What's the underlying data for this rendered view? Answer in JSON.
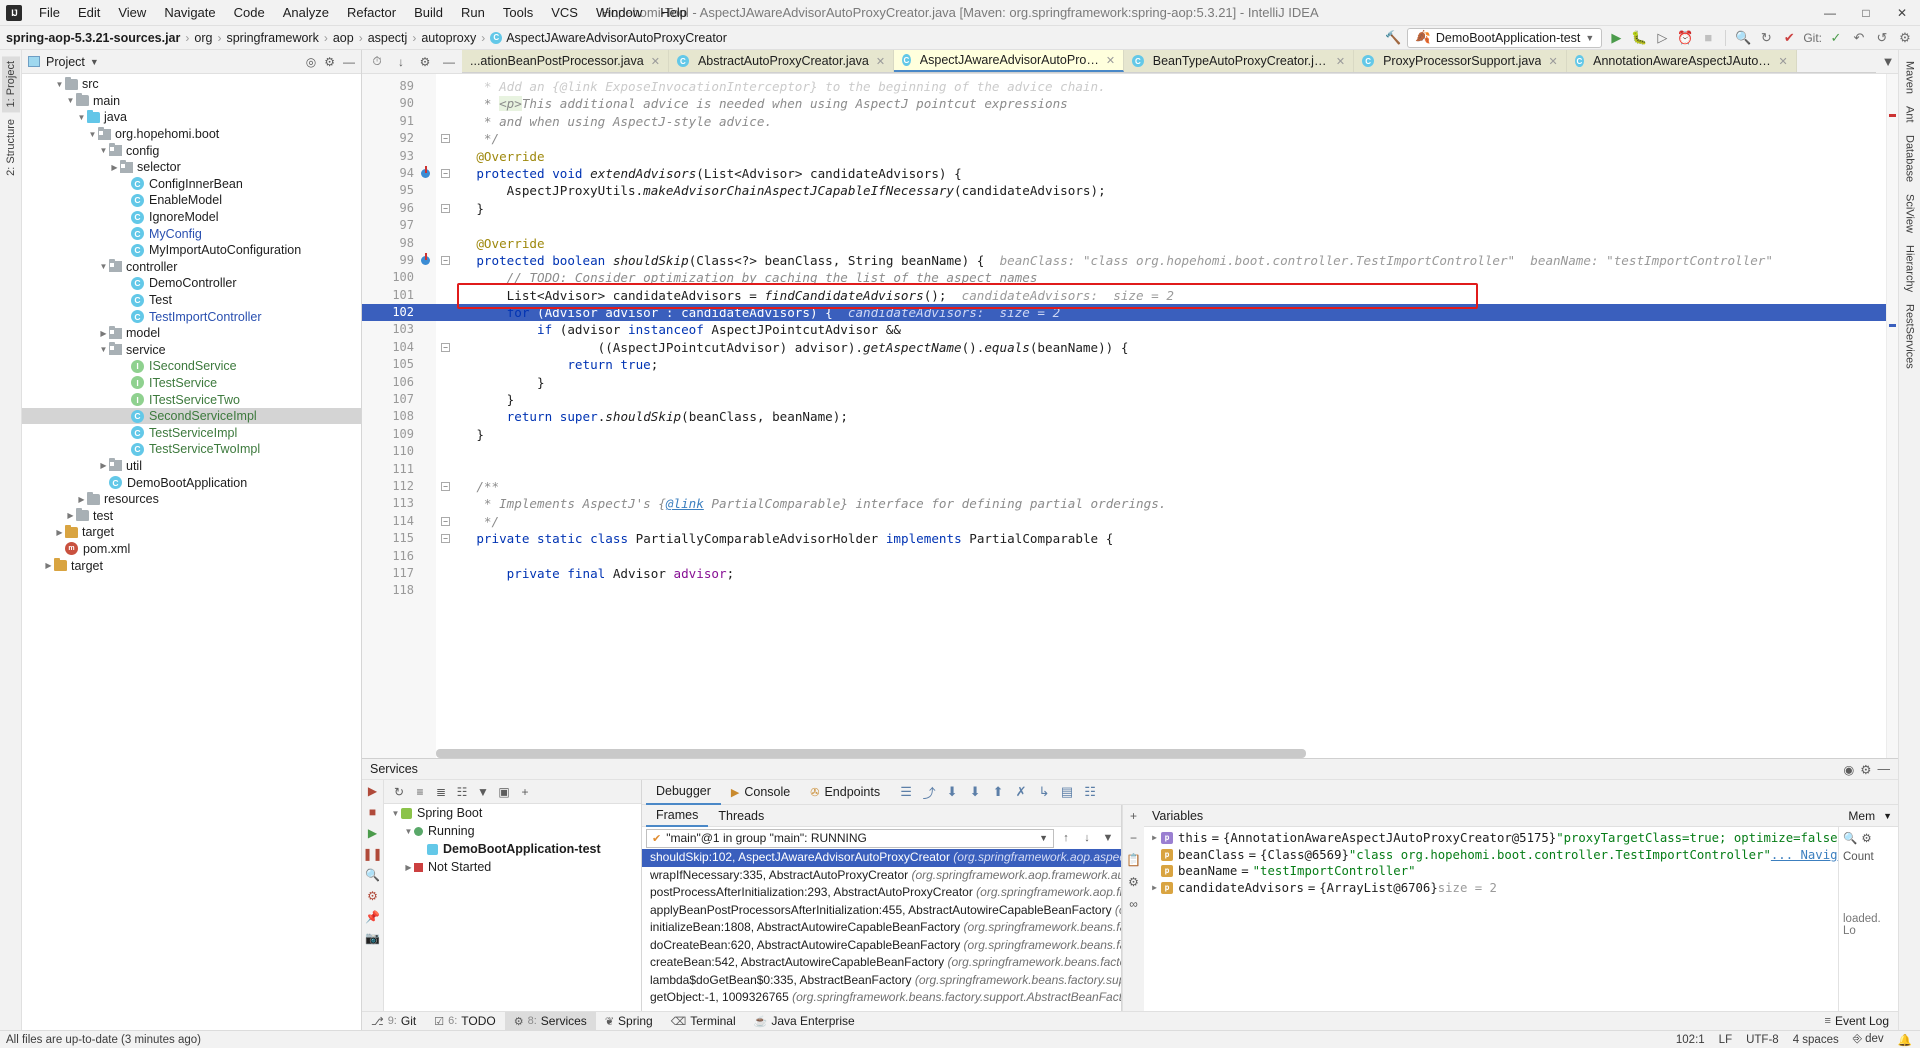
{
  "titlebar": {
    "logo": "IJ",
    "menus": [
      "File",
      "Edit",
      "View",
      "Navigate",
      "Code",
      "Analyze",
      "Refactor",
      "Build",
      "Run",
      "Tools",
      "VCS",
      "Window",
      "Help"
    ],
    "window_title": "Hopehomi-Tool - AspectJAwareAdvisorAutoProxyCreator.java [Maven: org.springframework:spring-aop:5.3.21] - IntelliJ IDEA",
    "minimize": "—",
    "maximize": "□",
    "close": "✕"
  },
  "navbar": {
    "crumbs": [
      "spring-aop-5.3.21-sources.jar",
      "org",
      "springframework",
      "aop",
      "aspectj",
      "autoproxy"
    ],
    "final_class": "AspectJAwareAdvisorAutoProxyCreator",
    "run_config": "DemoBootApplication-test",
    "git_label": "Git:"
  },
  "left_strip": {
    "tabs": [
      "1: Project",
      "2: Structure"
    ]
  },
  "right_strip": {
    "tabs": [
      "Maven",
      "Ant",
      "Database",
      "SciView",
      "Hierarchy",
      "RestServices"
    ]
  },
  "project": {
    "title": "Project",
    "tree": [
      {
        "indent": 2,
        "tw": "▼",
        "icon": "folder",
        "label": "src",
        "color": "dark"
      },
      {
        "indent": 3,
        "tw": "▼",
        "icon": "folder",
        "label": "main",
        "color": "dark"
      },
      {
        "indent": 4,
        "tw": "▼",
        "icon": "folder-blue",
        "label": "java",
        "color": "dark"
      },
      {
        "indent": 5,
        "tw": "▼",
        "icon": "pkg",
        "label": "org.hopehomi.boot",
        "color": "dark"
      },
      {
        "indent": 6,
        "tw": "▼",
        "icon": "pkg",
        "label": "config",
        "color": "dark"
      },
      {
        "indent": 7,
        "tw": "▶",
        "icon": "pkg",
        "label": "selector",
        "color": "dark"
      },
      {
        "indent": 8,
        "tw": "",
        "icon": "class",
        "label": "ConfigInnerBean",
        "color": "dark"
      },
      {
        "indent": 8,
        "tw": "",
        "icon": "class",
        "label": "EnableModel",
        "color": "dark"
      },
      {
        "indent": 8,
        "tw": "",
        "icon": "class",
        "label": "IgnoreModel",
        "color": "dark"
      },
      {
        "indent": 8,
        "tw": "",
        "icon": "class",
        "label": "MyConfig",
        "color": "blue"
      },
      {
        "indent": 8,
        "tw": "",
        "icon": "class",
        "label": "MyImportAutoConfiguration",
        "color": "dark"
      },
      {
        "indent": 6,
        "tw": "▼",
        "icon": "pkg",
        "label": "controller",
        "color": "dark"
      },
      {
        "indent": 8,
        "tw": "",
        "icon": "class",
        "label": "DemoController",
        "color": "dark"
      },
      {
        "indent": 8,
        "tw": "",
        "icon": "class",
        "label": "Test",
        "color": "dark"
      },
      {
        "indent": 8,
        "tw": "",
        "icon": "class",
        "label": "TestImportController",
        "color": "blue"
      },
      {
        "indent": 6,
        "tw": "▶",
        "icon": "pkg",
        "label": "model",
        "color": "dark"
      },
      {
        "indent": 6,
        "tw": "▼",
        "icon": "pkg",
        "label": "service",
        "color": "dark"
      },
      {
        "indent": 8,
        "tw": "",
        "icon": "iface",
        "label": "ISecondService",
        "color": "green"
      },
      {
        "indent": 8,
        "tw": "",
        "icon": "iface",
        "label": "ITestService",
        "color": "green"
      },
      {
        "indent": 8,
        "tw": "",
        "icon": "iface",
        "label": "ITestServiceTwo",
        "color": "green"
      },
      {
        "indent": 8,
        "tw": "",
        "icon": "class",
        "label": "SecondServiceImpl",
        "color": "green",
        "selected": true
      },
      {
        "indent": 8,
        "tw": "",
        "icon": "class",
        "label": "TestServiceImpl",
        "color": "green"
      },
      {
        "indent": 8,
        "tw": "",
        "icon": "class",
        "label": "TestServiceTwoImpl",
        "color": "green"
      },
      {
        "indent": 6,
        "tw": "▶",
        "icon": "pkg",
        "label": "util",
        "color": "dark"
      },
      {
        "indent": 6,
        "tw": "",
        "icon": "app",
        "label": "DemoBootApplication",
        "color": "dark"
      },
      {
        "indent": 4,
        "tw": "▶",
        "icon": "folder",
        "label": "resources",
        "color": "dark"
      },
      {
        "indent": 3,
        "tw": "▶",
        "icon": "folder",
        "label": "test",
        "color": "dark"
      },
      {
        "indent": 2,
        "tw": "▶",
        "icon": "folder-orange",
        "label": "target",
        "color": "dark"
      },
      {
        "indent": 2,
        "tw": "",
        "icon": "maven",
        "label": "pom.xml",
        "color": "dark"
      },
      {
        "indent": 1,
        "tw": "▶",
        "icon": "folder-orange",
        "label": "target",
        "color": "dark"
      }
    ]
  },
  "editor": {
    "tabs": [
      {
        "label": "...ationBeanPostProcessor.java",
        "active": false,
        "icon": false
      },
      {
        "label": "AbstractAutoProxyCreator.java",
        "active": false,
        "icon": true
      },
      {
        "label": "AspectJAwareAdvisorAutoProxyCreator.java",
        "active": true,
        "icon": true
      },
      {
        "label": "BeanTypeAutoProxyCreator.java",
        "active": false,
        "icon": true
      },
      {
        "label": "ProxyProcessorSupport.java",
        "active": false,
        "icon": true
      },
      {
        "label": "AnnotationAwareAspectJAutoProxyCre...",
        "active": false,
        "icon": true
      }
    ],
    "first_line_number": 89,
    "current_line": 102,
    "lines": [
      {
        "n": 89,
        "html": "     <span class='cmt'>* Add an {@link ExposeInvocationInterceptor} to the beginning of the advice chain.</span>",
        "clip": true
      },
      {
        "n": 90,
        "html": "     <span class='cmt'>* <span class='ptag'>&lt;p&gt;</span>This additional advice is needed when using AspectJ pointcut expressions</span>"
      },
      {
        "n": 91,
        "html": "     <span class='cmt'>* and when using AspectJ-style advice.</span>"
      },
      {
        "n": 92,
        "html": "     <span class='cmt'>*/</span>",
        "fold": true
      },
      {
        "n": 93,
        "html": "    <span class='anno'>@Override</span>"
      },
      {
        "n": 94,
        "html": "    <span class='kw'>protected</span> <span class='kw'>void</span> <span class='mth'>extendAdvisors</span>(List&lt;Advisor&gt; candidateAdvisors) {",
        "bp": true,
        "fold": true
      },
      {
        "n": 95,
        "html": "        AspectJProxyUtils.<span class='mth'>makeAdvisorChainAspectJCapableIfNecessary</span>(candidateAdvisors);"
      },
      {
        "n": 96,
        "html": "    }",
        "fold": true
      },
      {
        "n": 97,
        "html": ""
      },
      {
        "n": 98,
        "html": "    <span class='anno'>@Override</span>"
      },
      {
        "n": 99,
        "html": "    <span class='kw'>protected</span> <span class='kw'>boolean</span> <span class='mth'>shouldSkip</span>(Class&lt;?&gt; beanClass, String beanName) {  <span class='hint'>beanClass: \"class org.hopehomi.boot.controller.TestImportController\"  beanName: \"testImportController\"</span>",
        "bp": true,
        "fold": true
      },
      {
        "n": 100,
        "html": "        <span class='cmt'>// TODO: Consider optimization by caching the list of the aspect names</span>"
      },
      {
        "n": 101,
        "html": "        List&lt;Advisor&gt; candidateAdvisors = <span class='mth'>findCandidateAdvisors</span>();  <span class='hint'>candidateAdvisors:  size = 2</span>"
      },
      {
        "n": 102,
        "html": "        <span class='kw'>for</span> (Advisor advisor : candidateAdvisors) {  <span class='hint'>candidateAdvisors:  size = 2</span>",
        "current": true,
        "fold": true
      },
      {
        "n": 103,
        "html": "            <span class='kw'>if</span> (advisor <span class='kw'>instanceof</span> AspectJPointcutAdvisor &amp;&amp;"
      },
      {
        "n": 104,
        "html": "                    ((AspectJPointcutAdvisor) advisor).<span class='mth'>getAspectName</span>().<span class='mth'>equals</span>(beanName)) {",
        "fold": true
      },
      {
        "n": 105,
        "html": "                <span class='kw'>return</span> <span class='kw'>true</span>;"
      },
      {
        "n": 106,
        "html": "            }"
      },
      {
        "n": 107,
        "html": "        }"
      },
      {
        "n": 108,
        "html": "        <span class='kw'>return</span> <span class='kw'>super</span>.<span class='mth'>shouldSkip</span>(beanClass, beanName);"
      },
      {
        "n": 109,
        "html": "    }"
      },
      {
        "n": 110,
        "html": ""
      },
      {
        "n": 111,
        "html": ""
      },
      {
        "n": 112,
        "html": "    <span class='cmt'>/**</span>",
        "fold": true
      },
      {
        "n": 113,
        "html": "     <span class='cmt'>* Implements AspectJ's {<span class='link'>@link</span> <span class='cmt'>PartialComparable</span>} interface for defining partial orderings.</span>"
      },
      {
        "n": 114,
        "html": "     <span class='cmt'>*/</span>",
        "fold": true
      },
      {
        "n": 115,
        "html": "    <span class='kw'>private</span> <span class='kw'>static</span> <span class='kw'>class</span> PartiallyComparableAdvisorHolder <span class='kw'>implements</span> PartialComparable {",
        "fold": true
      },
      {
        "n": 116,
        "html": ""
      },
      {
        "n": 117,
        "html": "        <span class='kw'>private</span> <span class='kw'>final</span> Advisor <span class='fld'>advisor</span>;"
      },
      {
        "n": 118,
        "html": "",
        "clip": true
      }
    ]
  },
  "services": {
    "title": "Services",
    "toolbar_icons": [
      "collapse-all",
      "expand-all",
      "group",
      "filter",
      "layout",
      "add"
    ],
    "tree": [
      {
        "indent": 0,
        "tw": "▼",
        "icon": "spring",
        "label": "Spring Boot"
      },
      {
        "indent": 1,
        "tw": "▼",
        "icon": "running",
        "label": "Running"
      },
      {
        "indent": 2,
        "tw": "",
        "icon": "app",
        "label": "DemoBootApplication-test",
        "selected": true
      },
      {
        "indent": 1,
        "tw": "▶",
        "icon": "stopped",
        "label": "Not Started"
      }
    ]
  },
  "debugger": {
    "tabs": [
      {
        "label": "Debugger",
        "active": true,
        "icon": "bug-icon"
      },
      {
        "label": "Console",
        "active": false,
        "icon": "console-icon"
      },
      {
        "label": "Endpoints",
        "active": false,
        "icon": "endpoints-icon"
      }
    ],
    "frames_tabs": [
      "Frames",
      "Threads"
    ],
    "thread_selector": "\"main\"@1 in group \"main\": RUNNING",
    "frames": [
      {
        "method": "shouldSkip:102, AspectJAwareAdvisorAutoProxyCreator",
        "loc": "(org.springframework.aop.aspectj.autopro",
        "selected": true
      },
      {
        "method": "wrapIfNecessary:335, AbstractAutoProxyCreator",
        "loc": "(org.springframework.aop.framework.autoproxy"
      },
      {
        "method": "postProcessAfterInitialization:293, AbstractAutoProxyCreator",
        "loc": "(org.springframework.aop.framework"
      },
      {
        "method": "applyBeanPostProcessorsAfterInitialization:455, AbstractAutowireCapableBeanFactory",
        "loc": "(org.spring"
      },
      {
        "method": "initializeBean:1808, AbstractAutowireCapableBeanFactory",
        "loc": "(org.springframework.beans.factory.sup"
      },
      {
        "method": "doCreateBean:620, AbstractAutowireCapableBeanFactory",
        "loc": "(org.springframework.beans.factory.sup"
      },
      {
        "method": "createBean:542, AbstractAutowireCapableBeanFactory",
        "loc": "(org.springframework.beans.factory.suppo"
      },
      {
        "method": "lambda$doGetBean$0:335, AbstractBeanFactory",
        "loc": "(org.springframework.beans.factory.support)"
      },
      {
        "method": "getObject:-1, 1009326765",
        "loc": "(org.springframework.beans.factory.support.AbstractBeanFactory$$Lam"
      }
    ],
    "variables_title": "Variables",
    "mem_label": "Mem",
    "count_label": "Count",
    "loaded_label": "loaded. Lo",
    "variables": [
      {
        "tw": "▶",
        "kind": "self",
        "badge": "p",
        "name": "this",
        "eq": "=",
        "ref": "{AnnotationAwareAspectJAutoProxyCreator@5175}",
        "extra": "\"proxyTargetClass=true; optimize=false; opaque=false; exposeProxy=false; frozen=f"
      },
      {
        "tw": "",
        "kind": "param",
        "badge": "p",
        "name": "beanClass",
        "eq": "=",
        "ref": "{Class@6569}",
        "str": "\"class org.hopehomi.boot.controller.TestImportController\"",
        "nav": "... Navigate"
      },
      {
        "tw": "",
        "kind": "param",
        "badge": "p",
        "name": "beanName",
        "eq": "=",
        "str": "\"testImportController\""
      },
      {
        "tw": "▶",
        "kind": "param",
        "badge": "p",
        "name": "candidateAdvisors",
        "eq": "=",
        "ref": "{ArrayList@6706}",
        "hint": "size = 2"
      }
    ]
  },
  "tool_tabs": [
    {
      "key": "9:",
      "label": "Git",
      "icon": "git-icon"
    },
    {
      "key": "6:",
      "label": "TODO",
      "icon": "todo-icon"
    },
    {
      "key": "8:",
      "label": "Services",
      "icon": "services-icon",
      "active": true
    },
    {
      "key": "",
      "label": "Spring",
      "icon": "spring-icon"
    },
    {
      "key": "",
      "label": "Terminal",
      "icon": "terminal-icon"
    },
    {
      "key": "",
      "label": "Java Enterprise",
      "icon": "java-icon"
    }
  ],
  "statusbar": {
    "message": "All files are up-to-date (3 minutes ago)",
    "event_log": "Event Log",
    "caret": "102:1",
    "line_sep": "LF",
    "encoding": "UTF-8",
    "indent": "4 spaces",
    "branch": "dev"
  }
}
